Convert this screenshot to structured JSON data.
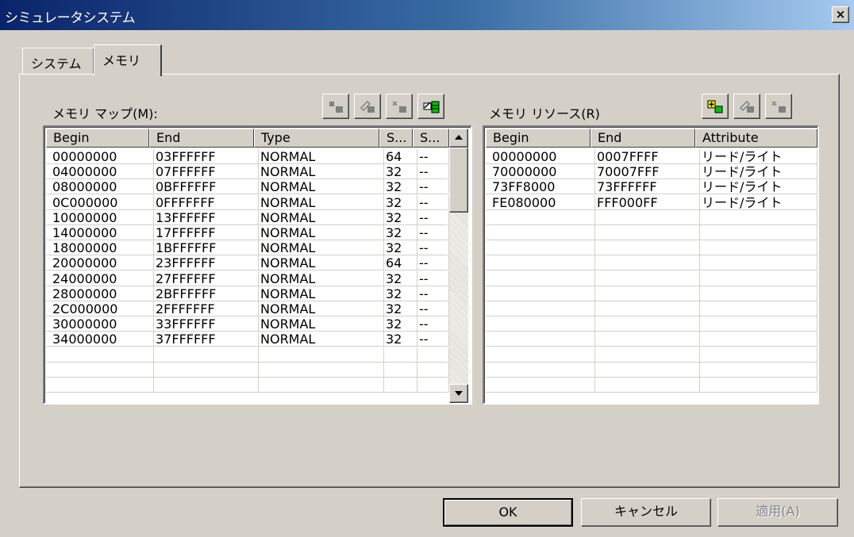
{
  "window": {
    "title": "シミュレータシステム",
    "close_label": "×"
  },
  "tabs": [
    {
      "label": "システム"
    },
    {
      "label": "メモリ"
    }
  ],
  "memory_map": {
    "label": "メモリ マップ(M):",
    "columns": [
      "Begin",
      "End",
      "Type",
      "S...",
      "S..."
    ],
    "rows": [
      [
        "00000000",
        "03FFFFFF",
        "NORMAL",
        "64",
        "--"
      ],
      [
        "04000000",
        "07FFFFFF",
        "NORMAL",
        "32",
        "--"
      ],
      [
        "08000000",
        "0BFFFFFF",
        "NORMAL",
        "32",
        "--"
      ],
      [
        "0C000000",
        "0FFFFFFF",
        "NORMAL",
        "32",
        "--"
      ],
      [
        "10000000",
        "13FFFFFF",
        "NORMAL",
        "32",
        "--"
      ],
      [
        "14000000",
        "17FFFFFF",
        "NORMAL",
        "32",
        "--"
      ],
      [
        "18000000",
        "1BFFFFFF",
        "NORMAL",
        "32",
        "--"
      ],
      [
        "20000000",
        "23FFFFFF",
        "NORMAL",
        "64",
        "--"
      ],
      [
        "24000000",
        "27FFFFFF",
        "NORMAL",
        "32",
        "--"
      ],
      [
        "28000000",
        "2BFFFFFF",
        "NORMAL",
        "32",
        "--"
      ],
      [
        "2C000000",
        "2FFFFFFF",
        "NORMAL",
        "32",
        "--"
      ],
      [
        "30000000",
        "33FFFFFF",
        "NORMAL",
        "32",
        "--"
      ],
      [
        "34000000",
        "37FFFFFF",
        "NORMAL",
        "32",
        "--"
      ]
    ]
  },
  "memory_resource": {
    "label": "メモリ リソース(R)",
    "columns": [
      "Begin",
      "End",
      "Attribute"
    ],
    "rows": [
      [
        "00000000",
        "0007FFFF",
        "リード/ライト"
      ],
      [
        "70000000",
        "70007FFF",
        "リード/ライト"
      ],
      [
        "73FF8000",
        "73FFFFFF",
        "リード/ライト"
      ],
      [
        "FE080000",
        "FFF000FF",
        "リード/ライト"
      ]
    ]
  },
  "buttons": {
    "ok": "OK",
    "cancel": "キャンセル",
    "apply": "適用(A)"
  }
}
